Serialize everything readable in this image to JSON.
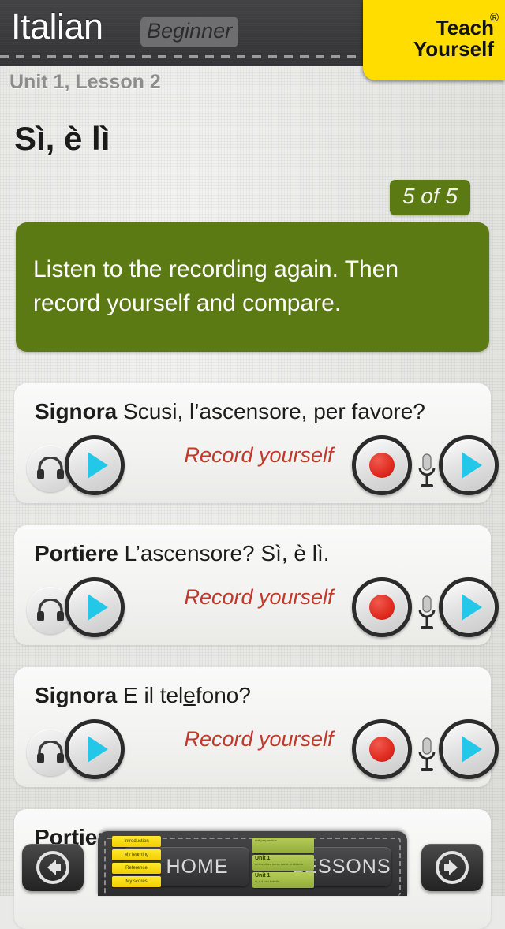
{
  "header": {
    "language": "Italian",
    "level": "Beginner",
    "logo_line1": "Teach",
    "logo_line2": "Yourself",
    "logo_reg": "®"
  },
  "lesson": {
    "unit_label": "Unit 1, Lesson 2",
    "title": "Sì, è lì",
    "progress": "5 of 5",
    "instruction": "Listen to the recording again. Then record yourself and compare."
  },
  "colors": {
    "green_panel": "#5c7a14",
    "record_red": "#c0392b",
    "play_cyan": "#23c7e8",
    "brand_yellow": "#ffdd00",
    "rec_dot": "#e02b20"
  },
  "dialogue": {
    "record_label": "Record yourself",
    "rows": [
      {
        "speaker": "Signora",
        "pre": "Scusi, l’ascensore, per favore?",
        "stress": "",
        "post": ""
      },
      {
        "speaker": "Portiere",
        "pre": "L’ascensore? Sì, è lì.",
        "stress": "",
        "post": ""
      },
      {
        "speaker": "Signora",
        "pre": "E il tel",
        "stress": "e",
        "post": "fono?"
      },
      {
        "speaker": "Portiere",
        "pre": "",
        "stress": "",
        "post": ""
      }
    ]
  },
  "nav": {
    "prev": "previous",
    "next": "next",
    "home_label": "HOME",
    "lessons_label": "LESSONS",
    "home_tabs": [
      "Introduction",
      "My learning",
      "Reference",
      "My scores"
    ],
    "lesson_cards": [
      {
        "title": "",
        "sub": "unit preparation"
      },
      {
        "title": "Unit 1",
        "sub": "arrivo, dove sono, come si chiama"
      },
      {
        "title": "Unit 1",
        "sub": "si, e il mio fratello"
      }
    ]
  }
}
